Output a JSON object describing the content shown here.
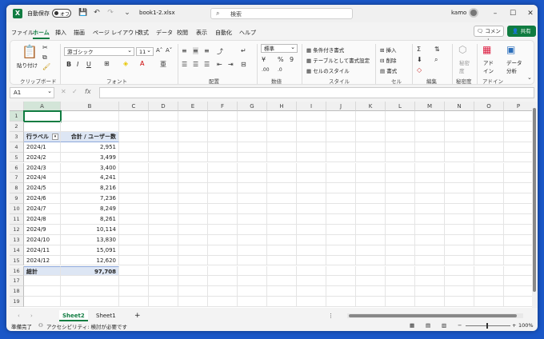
{
  "title": {
    "autosave": "自動保存",
    "toggle": "オフ",
    "document": "book1-2.xlsx",
    "search_placeholder": "検索",
    "user": "kamo"
  },
  "tabs": [
    "ファイル",
    "ホーム",
    "挿入",
    "描画",
    "ページ レイアウト",
    "数式",
    "データ",
    "校閲",
    "表示",
    "自動化",
    "ヘルプ"
  ],
  "active_tab": "ホーム",
  "comment_label": "コメント",
  "share_label": "共有",
  "ribbon": {
    "paste": "貼り付け",
    "font_name": "游ゴシック",
    "font_size": "11",
    "number_format": "標準",
    "conditional": "条件付き書式",
    "table_format": "テーブルとして書式設定",
    "cell_style": "セルのスタイル",
    "insert": "挿入",
    "delete": "削除",
    "format": "書式",
    "sensitivity": "秘密度",
    "addin": "アド イン",
    "analyze": "データ 分析",
    "groups": [
      "クリップボード",
      "フォント",
      "配置",
      "数値",
      "スタイル",
      "セル",
      "編集",
      "秘密度",
      "アドイン"
    ]
  },
  "namebox": "A1",
  "columns": [
    "A",
    "B",
    "C",
    "D",
    "E",
    "F",
    "G",
    "H",
    "I",
    "J",
    "K",
    "L",
    "M",
    "N",
    "O",
    "P"
  ],
  "rows": [
    "1",
    "2",
    "3",
    "4",
    "5",
    "6",
    "7",
    "8",
    "9",
    "10",
    "11",
    "12",
    "13",
    "14",
    "15",
    "16",
    "17",
    "18",
    "19"
  ],
  "pivot": {
    "header_row": "行ラベル",
    "header_value": "合計 / ユーザー数",
    "items": [
      {
        "label": "2024/1",
        "value": "2,951"
      },
      {
        "label": "2024/2",
        "value": "3,499"
      },
      {
        "label": "2024/3",
        "value": "3,400"
      },
      {
        "label": "2024/4",
        "value": "4,241"
      },
      {
        "label": "2024/5",
        "value": "8,216"
      },
      {
        "label": "2024/6",
        "value": "7,236"
      },
      {
        "label": "2024/7",
        "value": "8,249"
      },
      {
        "label": "2024/8",
        "value": "8,261"
      },
      {
        "label": "2024/9",
        "value": "10,114"
      },
      {
        "label": "2024/10",
        "value": "13,830"
      },
      {
        "label": "2024/11",
        "value": "15,091"
      },
      {
        "label": "2024/12",
        "value": "12,620"
      }
    ],
    "total_label": "総計",
    "total_value": "97,708"
  },
  "sheets": [
    "Sheet2",
    "Sheet1"
  ],
  "active_sheet": "Sheet2",
  "status": {
    "ready": "準備完了",
    "accessibility": "アクセシビリティ: 検討が必要です",
    "zoom": "100%"
  },
  "colors": {
    "accent": "#107c41",
    "pivot": "#dde6f4",
    "desktop": "#1a57c7"
  }
}
